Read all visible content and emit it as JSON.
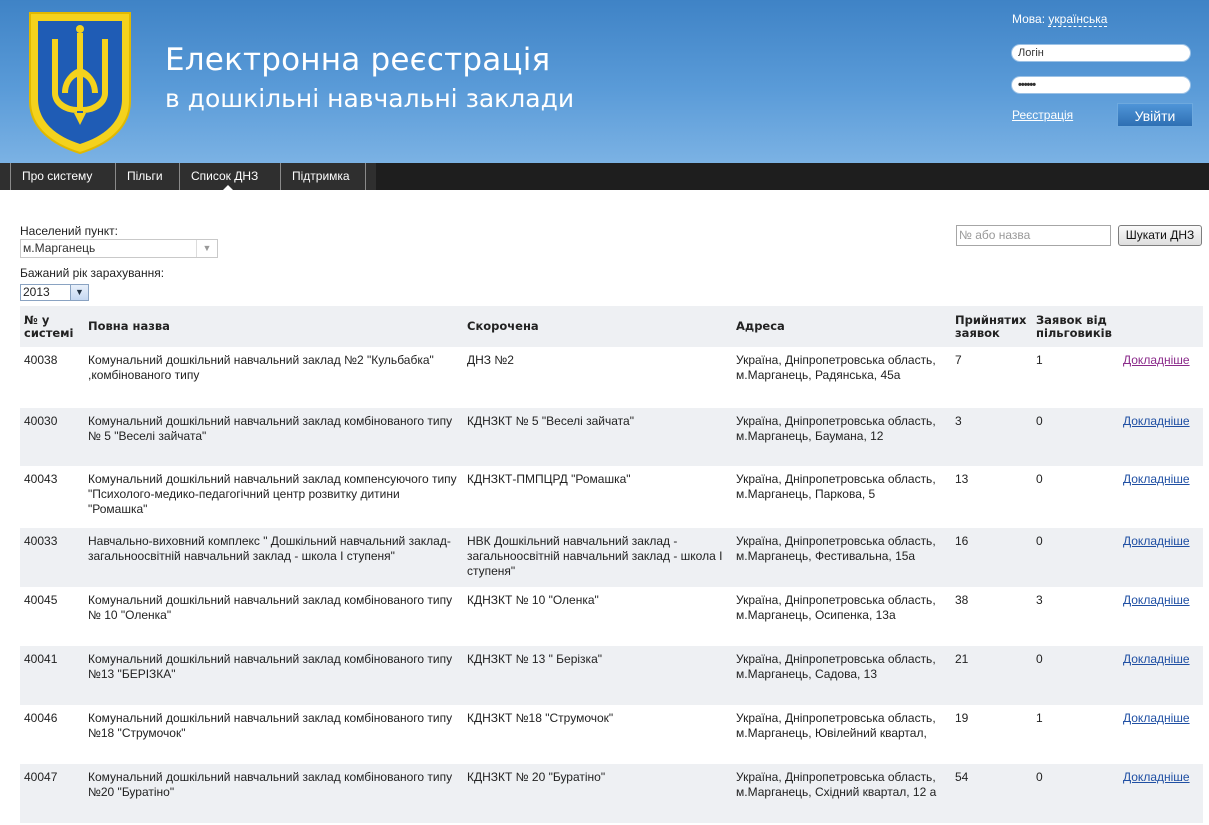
{
  "header": {
    "title_line1": "Електронна реєстрація",
    "title_line2": "в дошкільні навчальні заклади",
    "lang_label": "Мова:",
    "lang_value": "українська",
    "login_placeholder": "Логін",
    "password_value": "••••••",
    "register_link": "Реєстрація",
    "login_button": "Увійти",
    "accent": "#3f83c6"
  },
  "nav": {
    "items": [
      {
        "label": "Про систему"
      },
      {
        "label": "Пільги"
      },
      {
        "label": "Список ДНЗ"
      },
      {
        "label": "Підтримка"
      }
    ],
    "active": "Список ДНЗ"
  },
  "filters": {
    "city_label": "Населений пункт:",
    "city_value": "м.Марганець",
    "year_label": "Бажаний рік зарахування:",
    "year_value": "2013",
    "search_placeholder": "№ або назва",
    "search_button": "Шукати ДНЗ"
  },
  "table": {
    "headers": {
      "id": "№ у системі",
      "full": "Повна назва",
      "short": "Скорочена",
      "address": "Адреса",
      "accepted": "Прийнятих заявок",
      "privileged": "Заявок від пільговиків"
    },
    "rows": [
      {
        "id": "40038",
        "full": "Комунальний дошкільний навчальний заклад №2 \"Кульбабка\" ,комбінованого типу",
        "short": "ДНЗ №2",
        "address": "Україна, Дніпропетровська область, м.Марганець, Радянська, 45а",
        "accepted": "7",
        "privileged": "1",
        "link": "Докладніше"
      },
      {
        "id": "40030",
        "full": "Комунальний дошкільний навчальний заклад комбінованого типу № 5 \"Веселі зайчата\"",
        "short": "КДНЗКТ № 5 \"Веселі зайчата\"",
        "address": "Україна, Дніпропетровська область, м.Марганець, Баумана, 12",
        "accepted": "3",
        "privileged": "0",
        "link": "Докладніше"
      },
      {
        "id": "40043",
        "full": "Комунальний дошкільний навчальний заклад компенсуючого типу \"Психолого-медико-педагогічний центр розвитку дитини \"Ромашка\"",
        "short": "КДНЗКТ-ПМПЦРД \"Ромашка\"",
        "address": "Україна, Дніпропетровська область, м.Марганець, Паркова, 5",
        "accepted": "13",
        "privileged": "0",
        "link": "Докладніше"
      },
      {
        "id": "40033",
        "full": "Навчально-виховний комплекс \" Дошкільний навчальний заклад- загальноосвітній навчальний заклад - школа І ступеня\"",
        "short": "НВК Дошкільний навчальний заклад - загальноосвітній навчальний заклад - школа І ступеня\"",
        "address": "Україна, Дніпропетровська область, м.Марганець, Фестивальна, 15а",
        "accepted": "16",
        "privileged": "0",
        "link": "Докладніше"
      },
      {
        "id": "40045",
        "full": "Комунальний дошкільний навчальний заклад комбінованого типу № 10 \"Оленка\"",
        "short": "КДНЗКТ № 10 \"Оленка\"",
        "address": "Україна, Дніпропетровська область, м.Марганець, Осипенка, 13а",
        "accepted": "38",
        "privileged": "3",
        "link": "Докладніше"
      },
      {
        "id": "40041",
        "full": "Комунальний дошкільний навчальний заклад комбінованого типу №13 \"БЕРІЗКА\"",
        "short": "КДНЗКТ № 13 \" Берізка\"",
        "address": "Україна, Дніпропетровська область, м.Марганець, Садова, 13",
        "accepted": "21",
        "privileged": "0",
        "link": "Докладніше"
      },
      {
        "id": "40046",
        "full": "Комунальний дошкільний навчальний заклад комбінованого типу №18 \"Струмочок\"",
        "short": "КДНЗКТ №18 \"Струмочок\"",
        "address": "Україна, Дніпропетровська область, м.Марганець, Ювілейний квартал,",
        "accepted": "19",
        "privileged": "1",
        "link": "Докладніше"
      },
      {
        "id": "40047",
        "full": "Комунальний дошкільний навчальний заклад комбінованого типу №20 \"Буратіно\"",
        "short": "КДНЗКТ № 20 \"Буратіно\"",
        "address": "Україна, Дніпропетровська область, м.Марганець, Східний квартал, 12 а",
        "accepted": "54",
        "privileged": "0",
        "link": "Докладніше"
      }
    ]
  }
}
